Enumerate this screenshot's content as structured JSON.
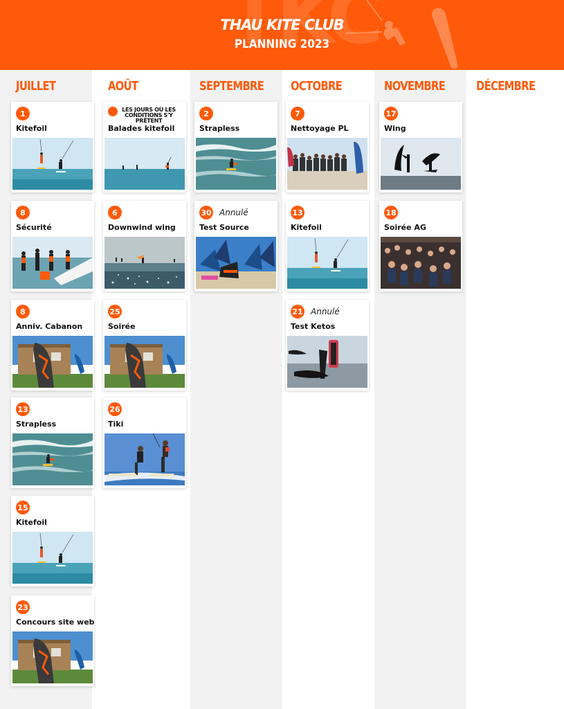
{
  "header": {
    "brand": "THAU KITE CLUB",
    "title": "PLANNING 2023",
    "background_color": "#ff5a0a"
  },
  "months": [
    {
      "name": "JUILLET",
      "events": [
        {
          "day": "1",
          "label": "Kitefoil",
          "photo": "kitefoil-photo"
        },
        {
          "day": "8",
          "label": "Sécurité",
          "photo": "securite-photo"
        },
        {
          "day": "8",
          "label": "Anniv. Cabanon",
          "photo": "cabanon-photo"
        },
        {
          "day": "13",
          "label": "Strapless",
          "photo": "strapless-photo"
        },
        {
          "day": "15",
          "label": "Kitefoil",
          "photo": "kitefoil-photo"
        },
        {
          "day": "23",
          "label": "Concours site web",
          "photo": "cabanon-photo"
        }
      ]
    },
    {
      "name": "AOÛT",
      "events": [
        {
          "day": "",
          "note": "LES JOURS OÙ LES CONDITIONS S'Y PRÊTENT",
          "label": "Balades kitefoil",
          "photo": "balade-photo"
        },
        {
          "day": "6",
          "label": "Downwind wing",
          "photo": "downwind-photo"
        },
        {
          "day": "25",
          "label": "Soirée",
          "photo": "cabanon-photo"
        },
        {
          "day": "26",
          "label": "Tiki",
          "photo": "tiki-photo"
        }
      ]
    },
    {
      "name": "SEPTEMBRE",
      "events": [
        {
          "day": "2",
          "label": "Strapless",
          "photo": "strapless-photo"
        },
        {
          "day": "30",
          "status": "Annulé",
          "label": "Test Source",
          "photo": "test-source-photo"
        }
      ]
    },
    {
      "name": "OCTOBRE",
      "events": [
        {
          "day": "7",
          "label": "Nettoyage PL",
          "photo": "nettoyage-photo"
        },
        {
          "day": "13",
          "label": "Kitefoil",
          "photo": "kitefoil-photo"
        },
        {
          "day": "21",
          "status": "Annulé",
          "label": "Test Ketos",
          "photo": "ketos-photo"
        }
      ]
    },
    {
      "name": "NOVEMBRE",
      "events": [
        {
          "day": "17",
          "label": "Wing",
          "photo": "wing-photo"
        },
        {
          "day": "18",
          "label": "Soirée AG",
          "photo": "soiree-ag-photo"
        }
      ]
    },
    {
      "name": "DÉCEMBRE",
      "events": []
    }
  ]
}
